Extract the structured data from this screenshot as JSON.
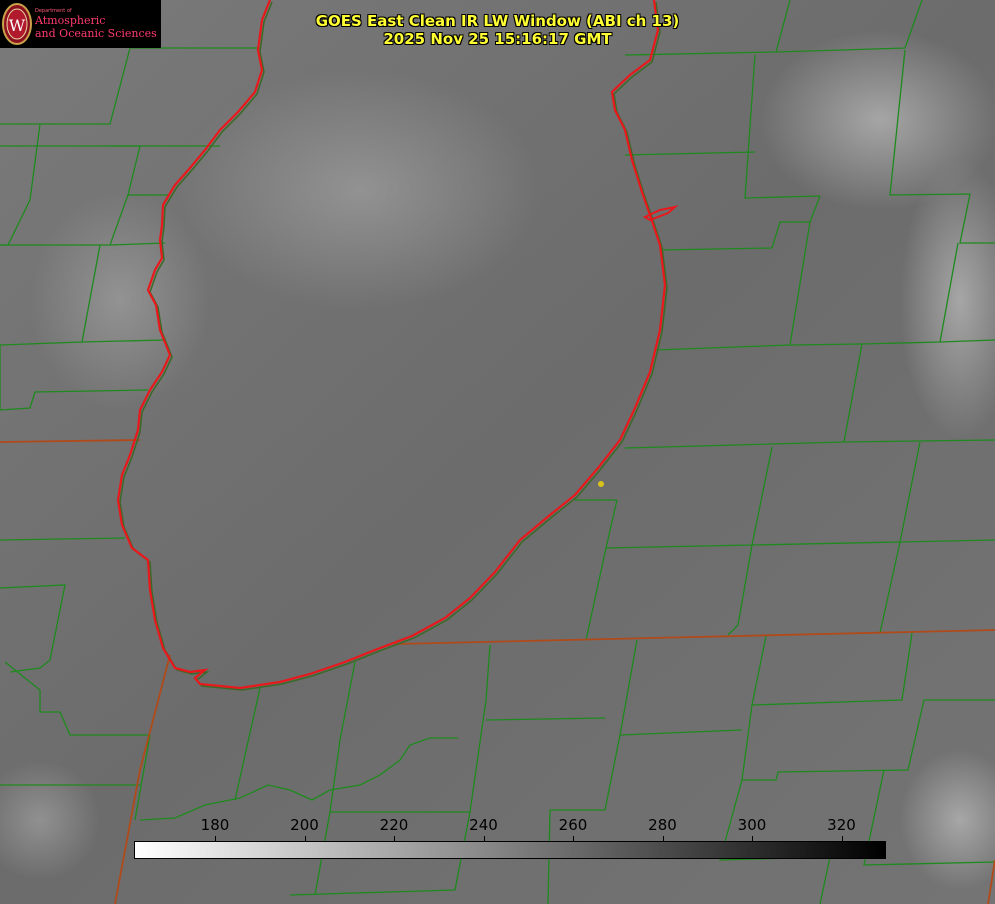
{
  "header": {
    "logo": {
      "department": "Department of",
      "line1": "Atmospheric",
      "line2": "and Oceanic Sciences",
      "seal_letter": "W"
    },
    "title_line1": "GOES East Clean IR LW Window (ABI ch 13)",
    "title_line2": "2025 Nov 25 15:16:17 GMT"
  },
  "colorbar": {
    "ticks": [
      "180",
      "200",
      "220",
      "240",
      "260",
      "280",
      "300",
      "320"
    ],
    "color_start": "#ffffff",
    "color_end": "#000000"
  },
  "colors": {
    "lake_outline": "#e8181c",
    "county_lines": "#1e8a1e",
    "state_line": "#b04a1a",
    "marker": "#d9c21a",
    "title_text": "#ffff33",
    "logo_text": "#ff3b6e"
  }
}
